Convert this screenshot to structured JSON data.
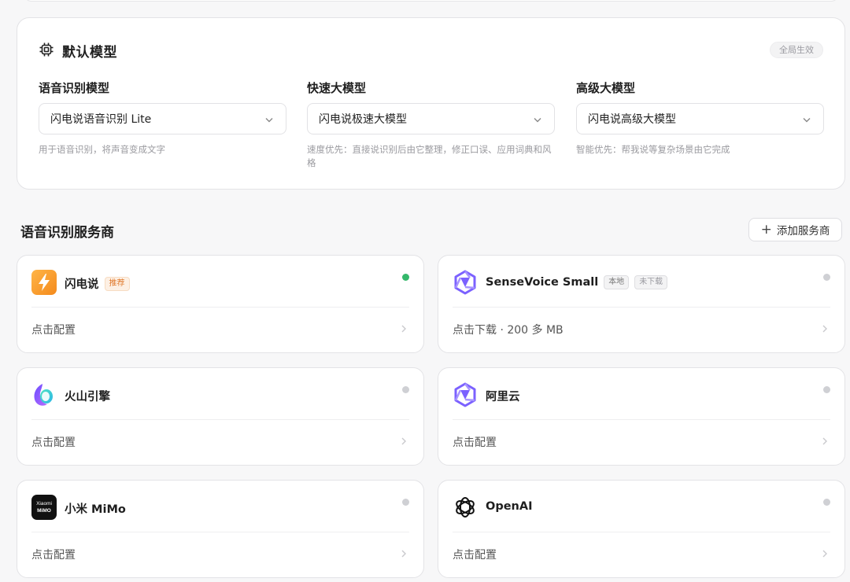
{
  "default_models": {
    "title": "默认模型",
    "badge": "全局生效",
    "columns": [
      {
        "label": "语音识别模型",
        "value": "闪电说语音识别 Lite",
        "desc": "用于语音识别，将声音变成文字"
      },
      {
        "label": "快速大模型",
        "value": "闪电说极速大模型",
        "desc": "速度优先：直接说识别后由它整理，修正口误、应用词典和风格"
      },
      {
        "label": "高级大模型",
        "value": "闪电说高级大模型",
        "desc": "智能优先：帮我说等复杂场景由它完成"
      }
    ]
  },
  "providers": {
    "title": "语音识别服务商",
    "add_label": "添加服务商",
    "items": [
      {
        "name": "闪电说",
        "tag": "推荐",
        "action": "点击配置",
        "active": true,
        "icon": "lightning-icon"
      },
      {
        "name": "SenseVoice Small",
        "tag": "本地",
        "tag2": "未下载",
        "action": "点击下载 · 200 多 MB",
        "active": false,
        "icon": "sensevoice-icon"
      },
      {
        "name": "火山引擎",
        "action": "点击配置",
        "active": false,
        "icon": "volcano-icon"
      },
      {
        "name": "阿里云",
        "action": "点击配置",
        "active": false,
        "icon": "aliyun-icon"
      },
      {
        "name": "小米 MiMo",
        "action": "点击配置",
        "active": false,
        "icon": "xiaomi-mimo-icon",
        "logo_text": "Xiaomi MiMO"
      },
      {
        "name": "OpenAI",
        "action": "点击配置",
        "active": false,
        "icon": "openai-icon"
      }
    ]
  },
  "colors": {
    "active_dot": "#34b86b",
    "inactive_dot": "#cfd0d4",
    "recommend_tag": "#e07a2e"
  }
}
